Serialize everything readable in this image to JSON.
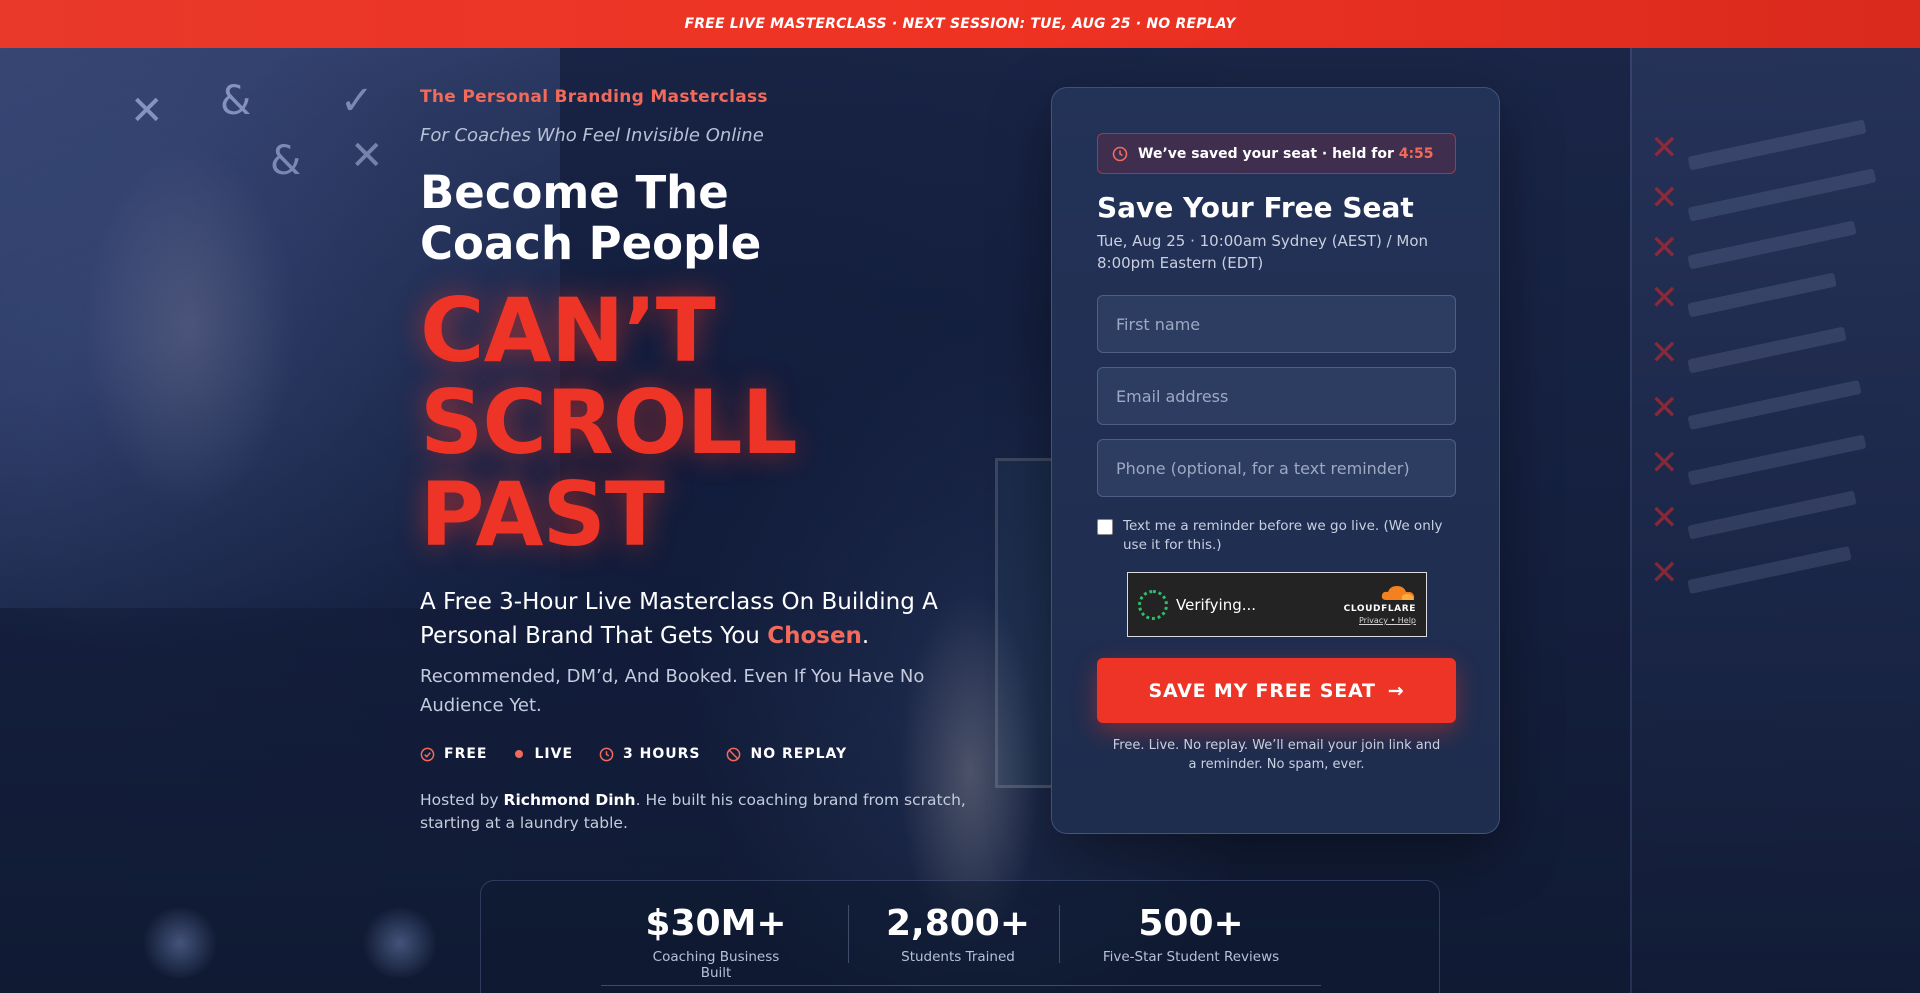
{
  "banner": {
    "text": "FREE LIVE MASTERCLASS · NEXT SESSION: TUE, AUG 25 · NO REPLAY"
  },
  "hero": {
    "eyebrow": "The Personal Branding Masterclass",
    "sub_eyebrow": "For Coaches Who Feel Invisible Online",
    "headline_line1": "Become The",
    "headline_line2": "Coach People",
    "headline_big_line1": "CAN’T",
    "headline_big_line2": "SCROLL",
    "headline_big_line3": "PAST",
    "lead_before": "A Free 3-Hour Live Masterclass On Building A Personal Brand That Gets You ",
    "lead_accent": "Chosen",
    "lead_after": ".",
    "sublead": "Recommended, DM’d, And Booked. Even If You Have No Audience Yet.",
    "badges": [
      {
        "icon": "check-circle-icon",
        "label": "FREE"
      },
      {
        "icon": "live-dot-icon",
        "label": "LIVE"
      },
      {
        "icon": "clock-icon",
        "label": "3 HOURS"
      },
      {
        "icon": "no-replay-icon",
        "label": "NO REPLAY"
      }
    ],
    "host_prefix": "Hosted by ",
    "host_name": "Richmond Dinh",
    "host_suffix": ". He built his coaching brand from scratch, starting at a laundry table."
  },
  "form": {
    "timer_text": "We’ve saved your seat · held for ",
    "timer_countdown": "4:55",
    "title": "Save Your Free Seat",
    "date": "Tue, Aug 25 · 10:00am Sydney (AEST) / Mon 8:00pm Eastern (EDT)",
    "first_name": {
      "placeholder": "First name",
      "value": ""
    },
    "email": {
      "placeholder": "Email address",
      "value": ""
    },
    "phone": {
      "placeholder": "Phone (optional, for a text reminder)",
      "value": ""
    },
    "sms_checkbox_label": "Text me a reminder before we go live. (We only use it for this.)",
    "sms_checked": false,
    "captcha": {
      "status": "Verifying...",
      "brand": "CLOUDFLARE",
      "privacy": "Privacy",
      "separator": "•",
      "help": "Help"
    },
    "submit_label": "SAVE MY FREE SEAT",
    "submit_arrow": "→",
    "disclaimer": "Free. Live. No replay. We’ll email your join link and a reminder. No spam, ever."
  },
  "stats": [
    {
      "value": "$30M+",
      "label": "Coaching Business Built"
    },
    {
      "value": "2,800+",
      "label": "Students Trained"
    },
    {
      "value": "500+",
      "label": "Five-Star Student Reviews"
    }
  ],
  "colors": {
    "accent_red": "#ee3426",
    "accent_coral": "#f26a5a",
    "background_navy": "#15203f",
    "card_navy": "#233257",
    "captcha_green": "#2ebd6b",
    "cloudflare_orange": "#f48120"
  }
}
